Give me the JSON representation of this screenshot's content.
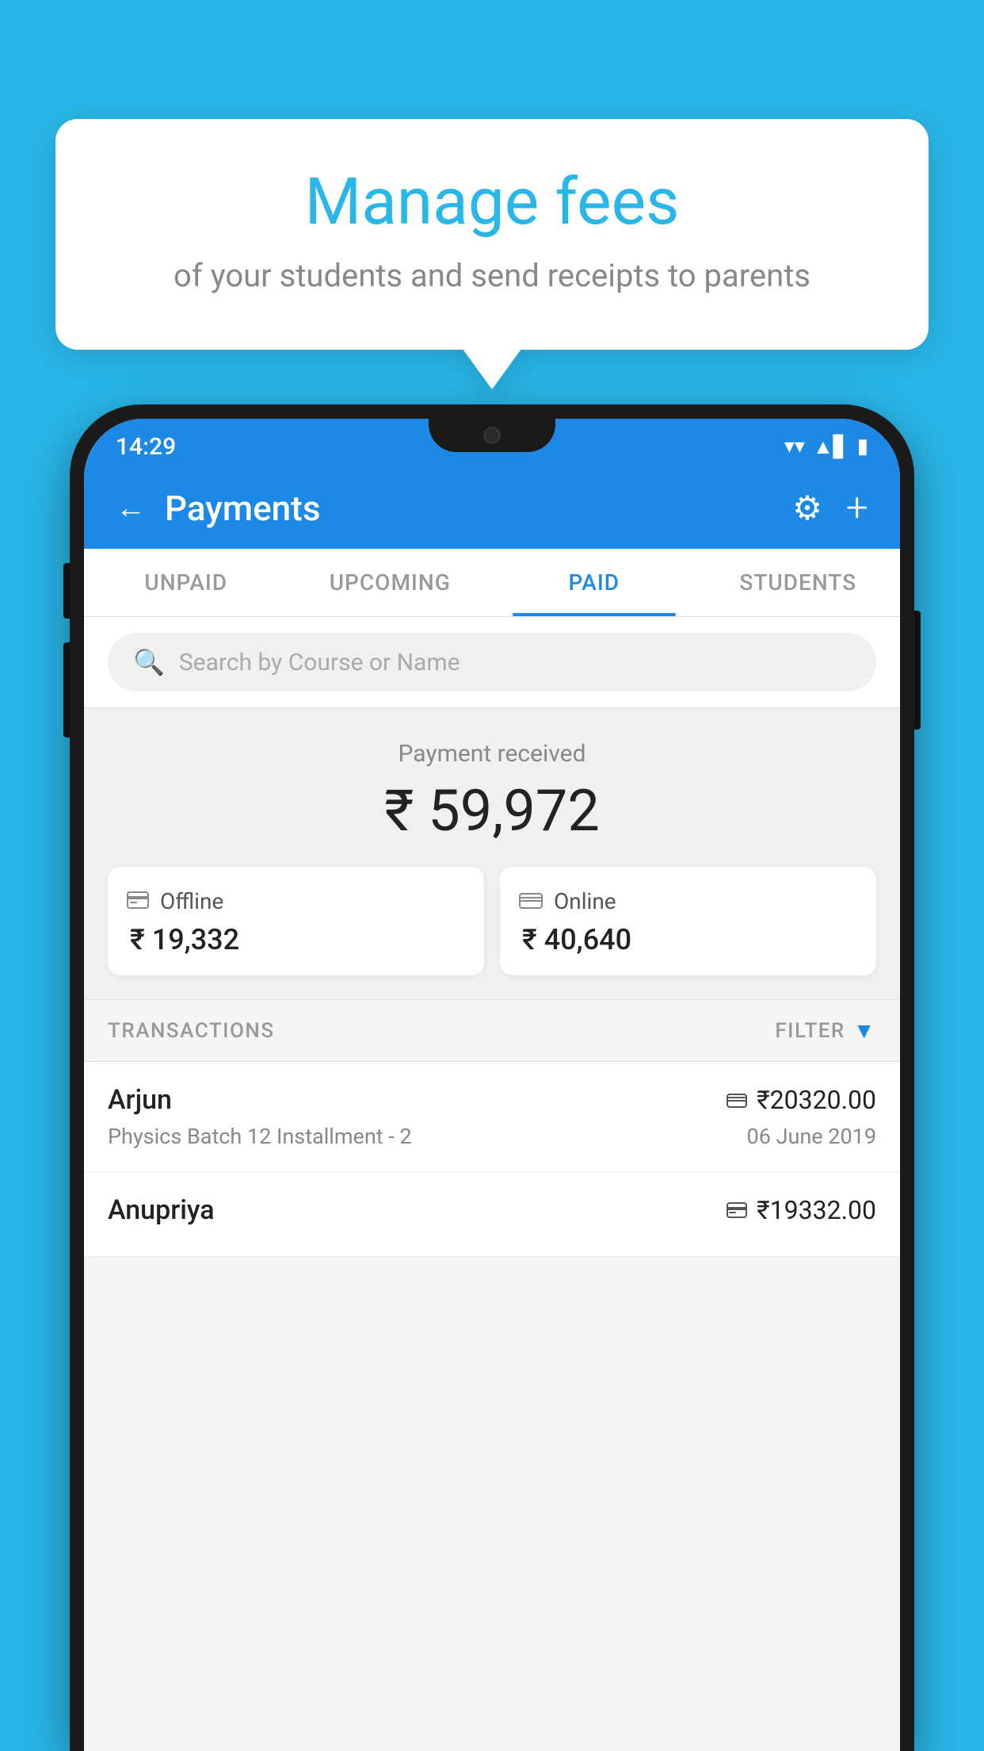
{
  "background_color": "#29b6e8",
  "bubble": {
    "title": "Manage fees",
    "subtitle": "of your students and send receipts to parents"
  },
  "status_bar": {
    "time": "14:29",
    "wifi": "▼",
    "signal": "▲",
    "battery": "▮"
  },
  "header": {
    "title": "Payments",
    "back_label": "←",
    "settings_label": "⚙",
    "add_label": "+"
  },
  "tabs": [
    {
      "label": "UNPAID",
      "active": false
    },
    {
      "label": "UPCOMING",
      "active": false
    },
    {
      "label": "PAID",
      "active": true
    },
    {
      "label": "STUDENTS",
      "active": false
    }
  ],
  "search": {
    "placeholder": "Search by Course or Name"
  },
  "payment_summary": {
    "label": "Payment received",
    "amount": "₹ 59,972",
    "offline": {
      "label": "Offline",
      "amount": "₹ 19,332"
    },
    "online": {
      "label": "Online",
      "amount": "₹ 40,640"
    }
  },
  "transactions_header": {
    "label": "TRANSACTIONS",
    "filter_label": "FILTER"
  },
  "transactions": [
    {
      "name": "Arjun",
      "batch": "Physics Batch 12 Installment - 2",
      "amount": "₹20320.00",
      "date": "06 June 2019",
      "method": "online"
    },
    {
      "name": "Anupriya",
      "batch": "",
      "amount": "₹19332.00",
      "date": "",
      "method": "offline"
    }
  ]
}
